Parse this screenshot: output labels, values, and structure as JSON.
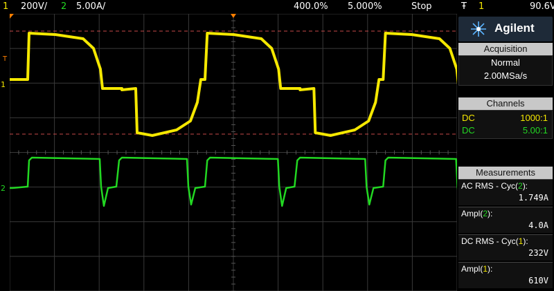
{
  "top_bar": {
    "ch1_num": "1",
    "ch1_scale": "200V/",
    "ch2_num": "2",
    "ch2_scale": "5.00A/",
    "timebase": "400.0%",
    "sample_rate": "5.000%",
    "run_state": "Stop",
    "trigger_icon": "trigger-edge-icon",
    "trigger_symbol": "Ŧ",
    "trigger_channel": "1",
    "trigger_level": "90.6V"
  },
  "panel": {
    "brand": "Agilent",
    "acquisition": {
      "header": "Acquisition",
      "mode": "Normal",
      "rate": "2.00MSa/s"
    },
    "channels": {
      "header": "Channels",
      "rows": [
        {
          "coupling": "DC",
          "probe": "1000:1",
          "color": "#f5e800"
        },
        {
          "coupling": "DC",
          "probe": "5.00:1",
          "color": "#22d822"
        }
      ]
    },
    "measurements": {
      "header": "Measurements",
      "items": [
        {
          "label_pre": "AC RMS - Cyc(",
          "ch": "2",
          "label_post": "):",
          "value": "1.749A",
          "ch_color": "#22d822"
        },
        {
          "label_pre": "Ampl(",
          "ch": "2",
          "label_post": "):",
          "value": "4.0A",
          "ch_color": "#22d822"
        },
        {
          "label_pre": "DC RMS - Cyc(",
          "ch": "1",
          "label_post": "):",
          "value": "232V",
          "ch_color": "#f5e800"
        },
        {
          "label_pre": "Ampl(",
          "ch": "1",
          "label_post": "):",
          "value": "610V",
          "ch_color": "#f5e800"
        }
      ]
    }
  },
  "scope": {
    "ch1_marker": "1",
    "ch2_marker": "2",
    "trigger_marker": "T",
    "colors": {
      "ch1": "#f5e800",
      "ch2": "#22d822",
      "grid": "#3a3a3a",
      "cursor": "#c84a4a",
      "trigger": "#ff7f00"
    }
  }
}
